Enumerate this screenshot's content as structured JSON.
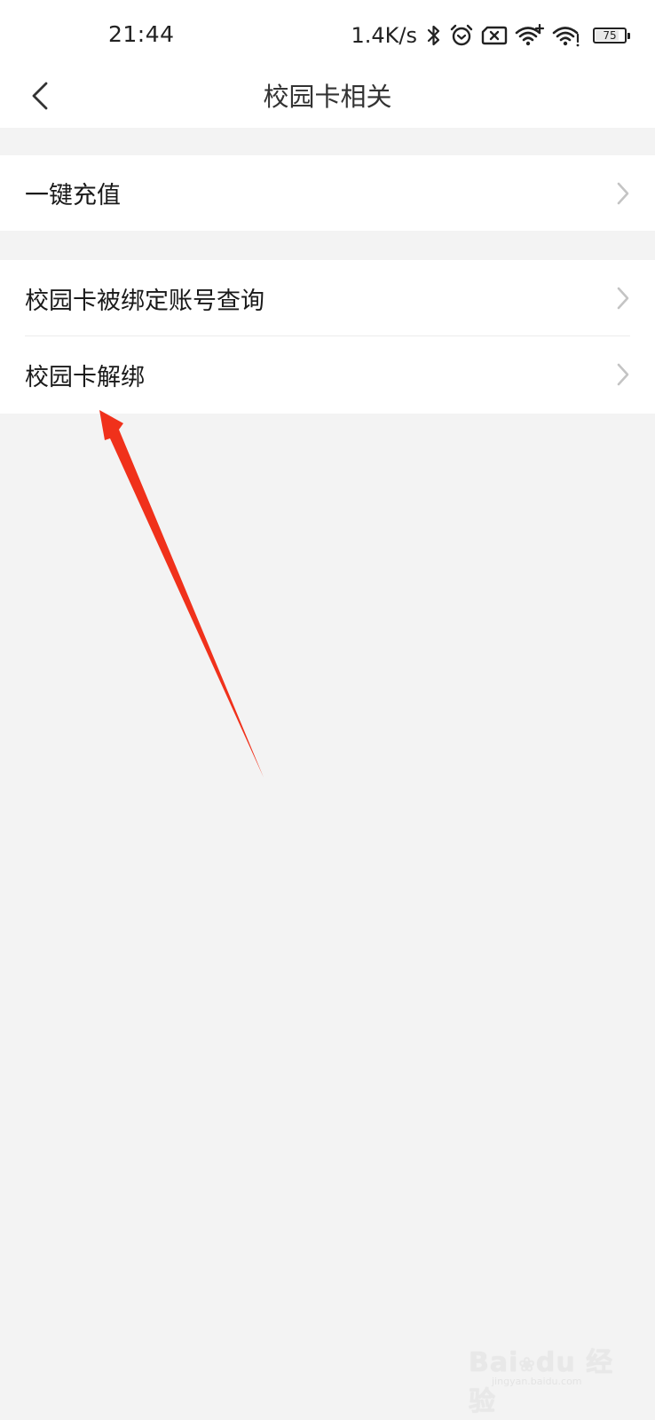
{
  "status_bar": {
    "time": "21:44",
    "net_speed": "1.4K/s",
    "battery_level": "75",
    "icons": [
      "bluetooth-icon",
      "alarm-icon",
      "sim-disabled-icon",
      "wifi-plus-icon",
      "wifi-icon",
      "battery-icon"
    ]
  },
  "header": {
    "title": "校园卡相关",
    "back_icon": "chevron-left-icon"
  },
  "groups": [
    {
      "items": [
        {
          "label": "一键充值",
          "icon": "chevron-right-icon"
        }
      ]
    },
    {
      "items": [
        {
          "label": "校园卡被绑定账号查询",
          "icon": "chevron-right-icon"
        },
        {
          "label": "校园卡解绑",
          "icon": "chevron-right-icon"
        }
      ]
    }
  ],
  "watermark": {
    "text": "Bai du 经验",
    "subtext": "jingyan.baidu.com"
  },
  "colors": {
    "background": "#f3f3f3",
    "surface": "#ffffff",
    "text_primary": "#1a1a1a",
    "chevron": "#c4c4c4",
    "annotation_arrow": "#f0311b"
  }
}
